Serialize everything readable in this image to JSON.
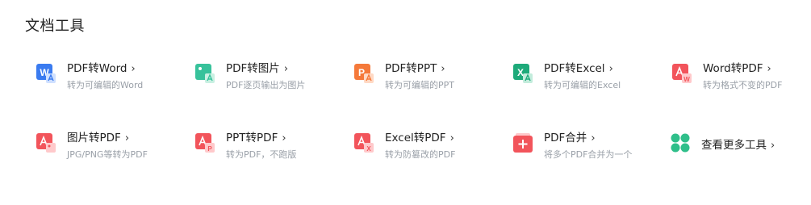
{
  "section": {
    "title": "文档工具"
  },
  "tools": [
    {
      "title": "PDF转Word",
      "desc": "转为可编辑的Word",
      "icon": "pdf-to-word-icon",
      "color": "#3a7bf0"
    },
    {
      "title": "PDF转图片",
      "desc": "PDF逐页输出为图片",
      "icon": "pdf-to-image-icon",
      "color": "#37c29b"
    },
    {
      "title": "PDF转PPT",
      "desc": "转为可编辑的PPT",
      "icon": "pdf-to-ppt-icon",
      "color": "#f5793a"
    },
    {
      "title": "PDF转Excel",
      "desc": "转为可编辑的Excel",
      "icon": "pdf-to-excel-icon",
      "color": "#1eaa7a"
    },
    {
      "title": "Word转PDF",
      "desc": "转为格式不变的PDF",
      "icon": "word-to-pdf-icon",
      "color": "#f2545b"
    },
    {
      "title": "图片转PDF",
      "desc": "JPG/PNG等转为PDF",
      "icon": "image-to-pdf-icon",
      "color": "#f2545b"
    },
    {
      "title": "PPT转PDF",
      "desc": "转为PDF，不跑版",
      "icon": "ppt-to-pdf-icon",
      "color": "#f2545b"
    },
    {
      "title": "Excel转PDF",
      "desc": "转为防篡改的PDF",
      "icon": "excel-to-pdf-icon",
      "color": "#f2545b"
    },
    {
      "title": "PDF合并",
      "desc": "将多个PDF合并为一个",
      "icon": "pdf-merge-icon",
      "color": "#f2545b"
    },
    {
      "title": "查看更多工具",
      "icon": "more-tools-icon",
      "color": "#2fbf8a"
    }
  ],
  "chevron": "›"
}
